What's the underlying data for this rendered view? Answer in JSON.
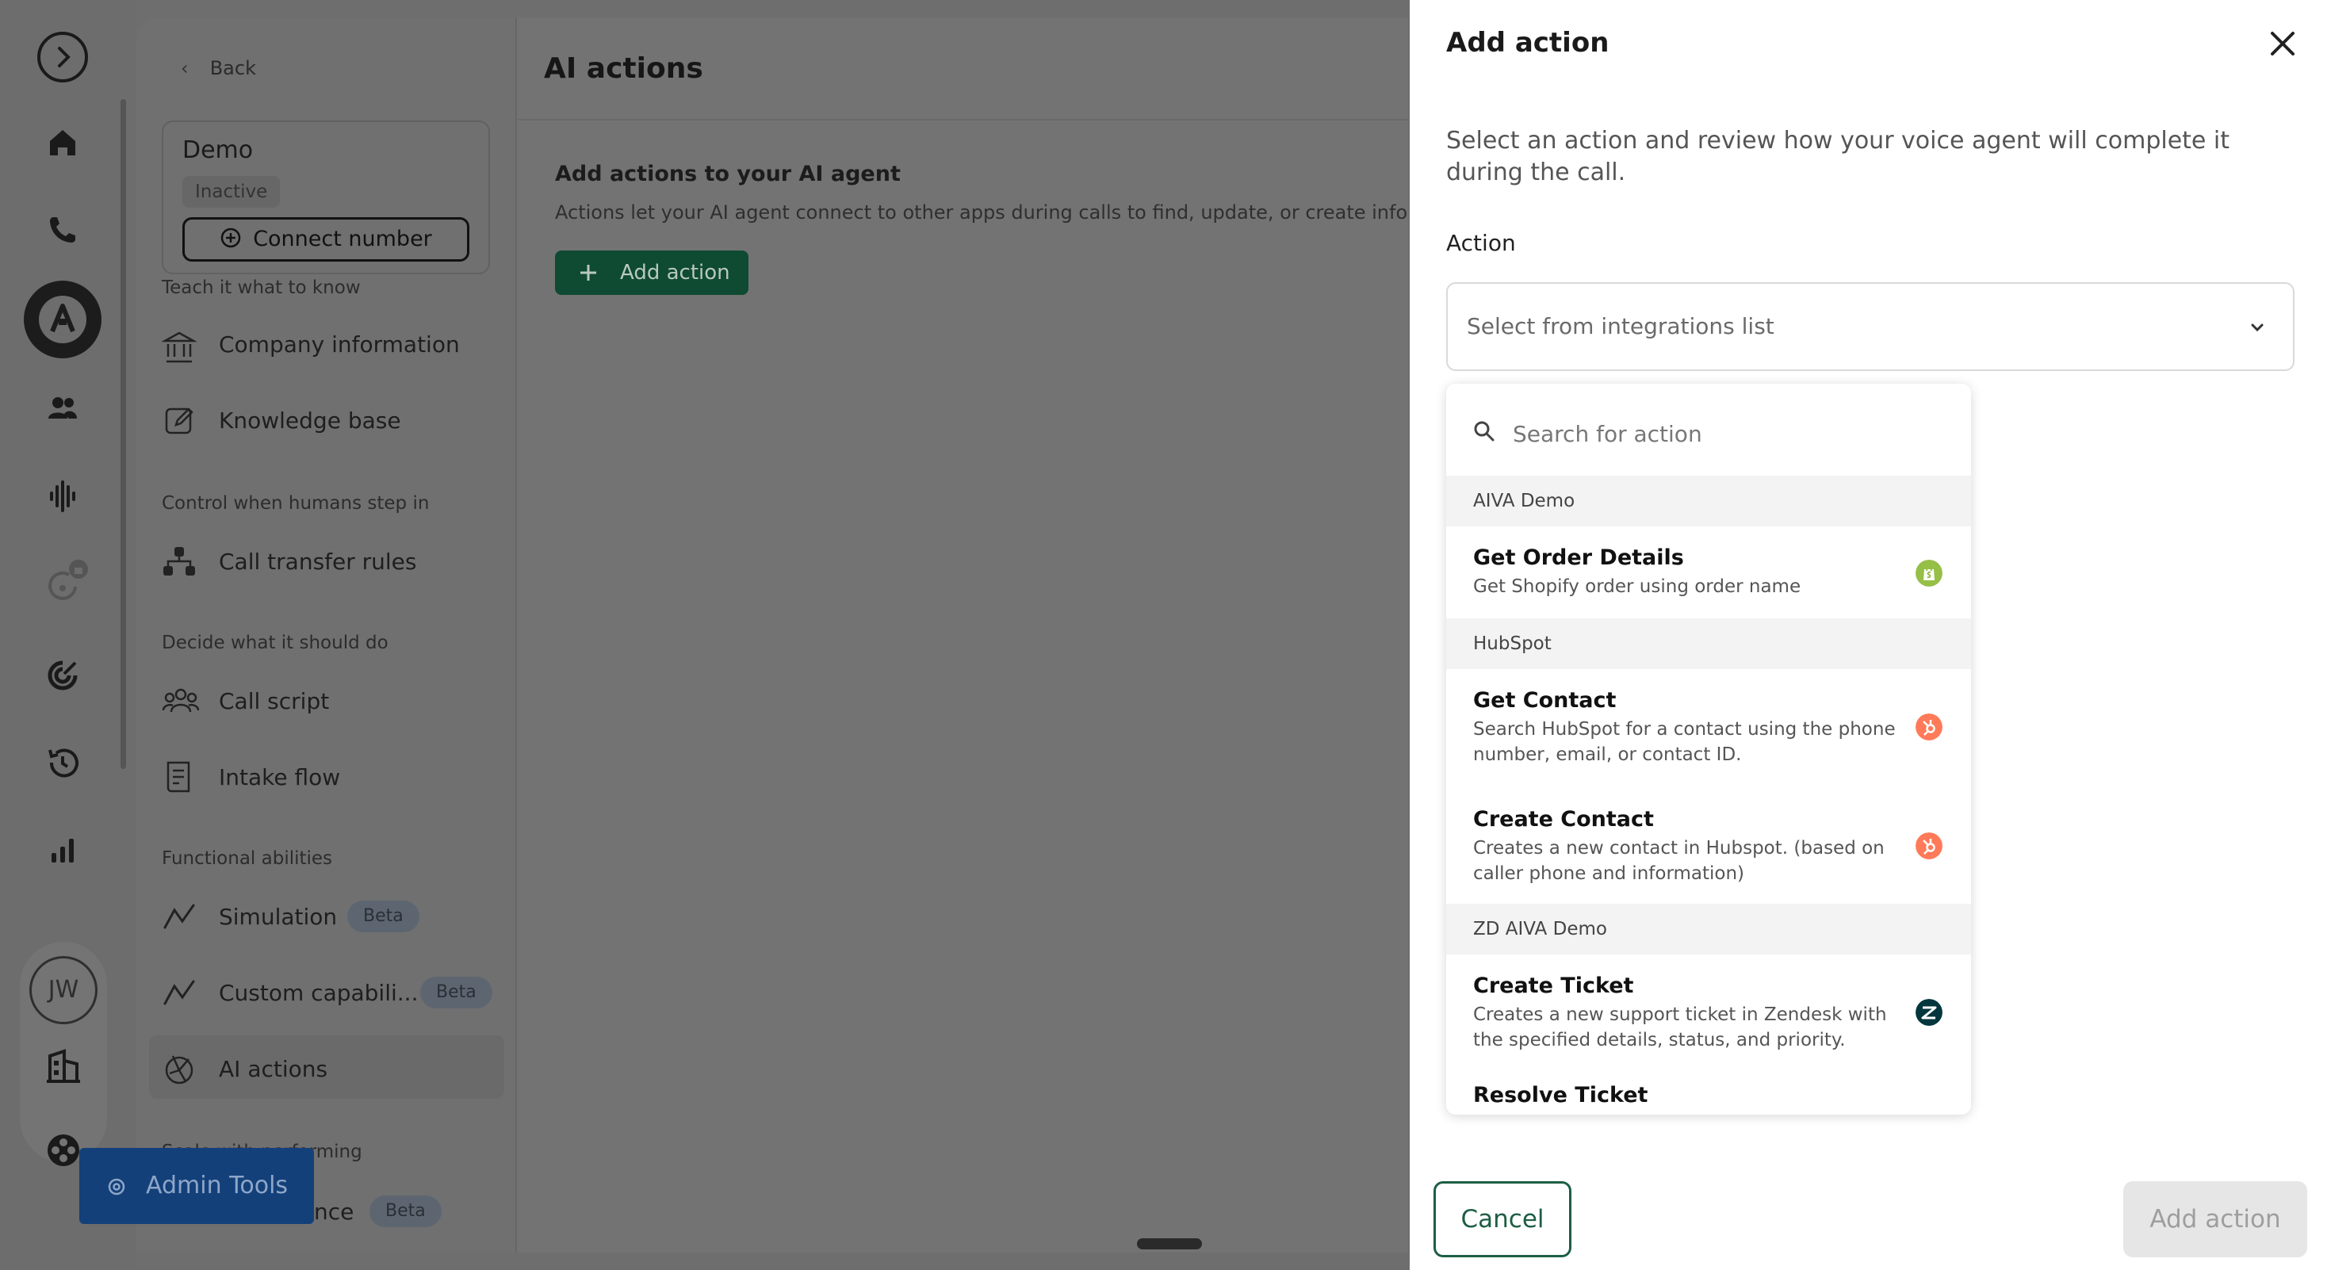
{
  "sidebar": {
    "back_label": "Back",
    "agent_name": "Demo",
    "agent_status": "Inactive",
    "connect_label": "Connect number",
    "sections": {
      "teach": "Teach it what to know",
      "control": "Control when humans step in",
      "decide": "Decide what it should do",
      "functional": "Functional abilities",
      "scale": "Scale with performing"
    },
    "items": {
      "company": "Company information",
      "knowledge": "Knowledge base",
      "transfer": "Call transfer rules",
      "script": "Call script",
      "intake": "Intake flow",
      "simulation": "Simulation",
      "custom": "Custom capabili...",
      "ai_actions": "AI actions",
      "performance": "nce"
    },
    "beta": "Beta",
    "avatar_initials": "JW",
    "notification_badge": "8"
  },
  "main": {
    "title": "AI actions",
    "heading": "Add actions to your AI agent",
    "description": "Actions let your AI agent connect to other apps during calls to find, update, or create information. A",
    "add_action": "Add action"
  },
  "admin_tools": "Admin Tools",
  "drawer": {
    "title": "Add action",
    "description": "Select an action and review how your voice agent will complete it during the call.",
    "action_label": "Action",
    "select_placeholder": "Select from integrations list",
    "search_placeholder": "Search for action",
    "groups": [
      {
        "name": "AIVA Demo",
        "items": [
          {
            "title": "Get Order Details",
            "desc": "Get Shopify order using order name",
            "icon": "shopify-icon"
          }
        ]
      },
      {
        "name": "HubSpot",
        "items": [
          {
            "title": "Get Contact",
            "desc": "Search HubSpot for a contact using the phone number, email, or contact ID.",
            "icon": "hubspot-icon"
          },
          {
            "title": "Create Contact",
            "desc": "Creates a new contact in Hubspot. (based on caller phone and information)",
            "icon": "hubspot-icon"
          }
        ]
      },
      {
        "name": "ZD AIVA Demo",
        "items": [
          {
            "title": "Create Ticket",
            "desc": "Creates a new support ticket in Zendesk with the specified details, status, and priority.",
            "icon": "zendesk-icon"
          },
          {
            "title": "Resolve Ticket",
            "desc": "",
            "icon": ""
          }
        ]
      }
    ],
    "cancel": "Cancel",
    "submit": "Add action"
  },
  "colors": {
    "brand_green": "#1d5e44",
    "shopify": "#95bf47",
    "hubspot": "#ff7a59",
    "zendesk": "#03363d",
    "admin_blue": "#14407a"
  }
}
